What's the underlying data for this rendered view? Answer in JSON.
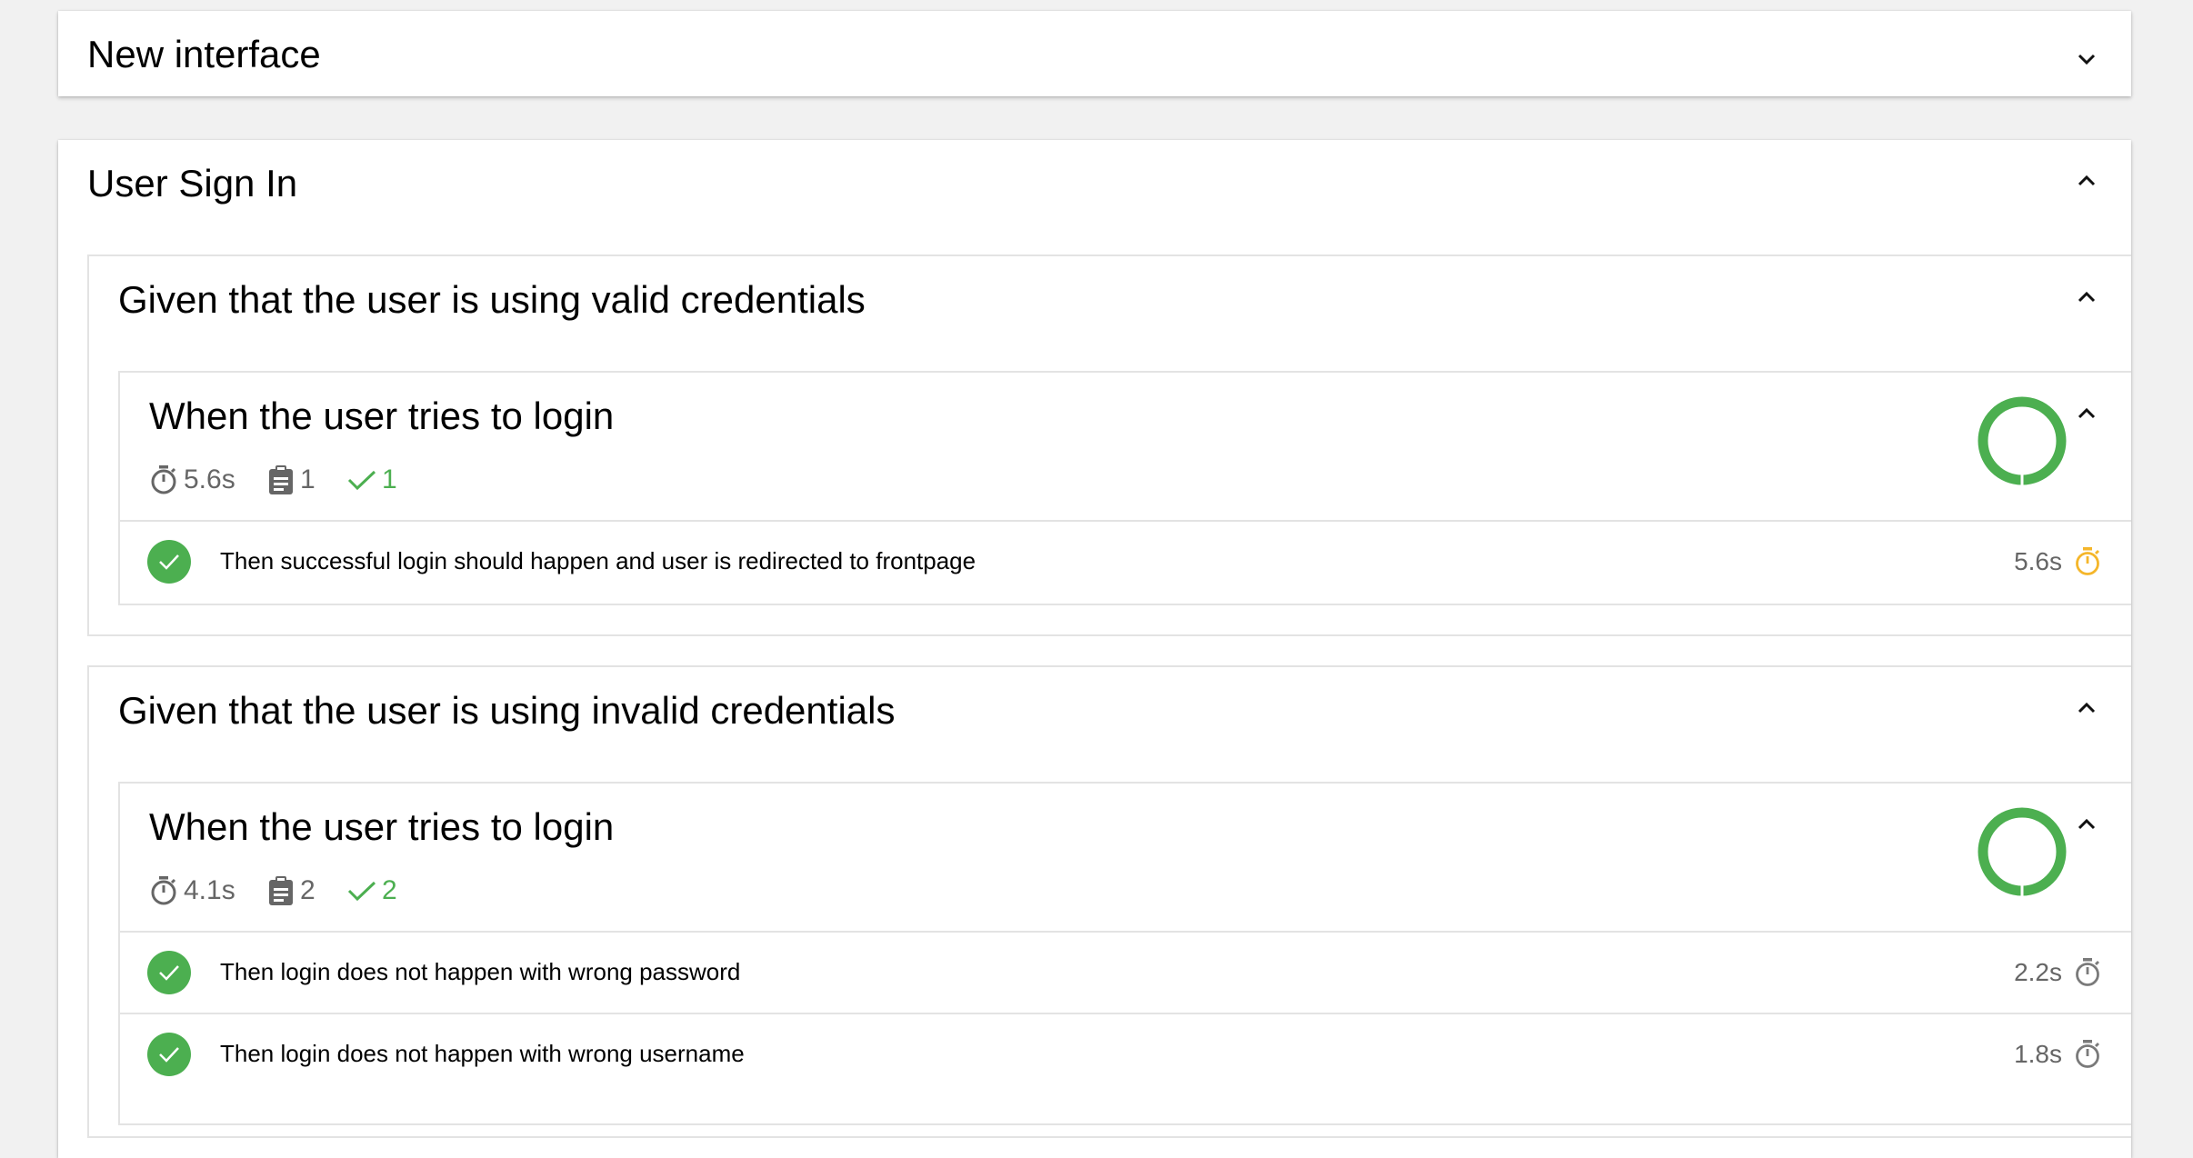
{
  "colors": {
    "pass": "#4caf50",
    "slow_timer": "#f5b62a",
    "timer": "#7a7a7a",
    "muted": "#666666"
  },
  "features": [
    {
      "title": "New interface",
      "expanded": false,
      "toggle_icon": "chevron-down-icon"
    },
    {
      "title": "User Sign In",
      "expanded": true,
      "toggle_icon": "chevron-up-icon",
      "sections": [
        {
          "title": "Given that the user is using valid credentials",
          "toggle_icon": "chevron-up-icon",
          "behavior": {
            "title": "When the user tries to login",
            "toggle_icon": "chevron-up-icon",
            "stats": {
              "duration": "5.6s",
              "tests": "1",
              "passed": "1"
            },
            "pass_fraction": 1.0,
            "steps": [
              {
                "text": "Then successful login should happen and user is redirected to frontpage",
                "duration": "5.6s",
                "status": "passed",
                "slow": true
              }
            ]
          }
        },
        {
          "title": "Given that the user is using invalid credentials",
          "toggle_icon": "chevron-up-icon",
          "behavior": {
            "title": "When the user tries to login",
            "toggle_icon": "chevron-up-icon",
            "stats": {
              "duration": "4.1s",
              "tests": "2",
              "passed": "2"
            },
            "pass_fraction": 1.0,
            "steps": [
              {
                "text": "Then login does not happen with wrong password",
                "duration": "2.2s",
                "status": "passed",
                "slow": false
              },
              {
                "text": "Then login does not happen with wrong username",
                "duration": "1.8s",
                "status": "passed",
                "slow": false
              }
            ]
          }
        }
      ]
    }
  ]
}
